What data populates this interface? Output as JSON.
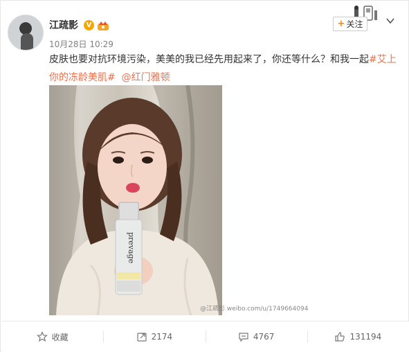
{
  "user": {
    "name": "江疏影",
    "verified_badge": "V",
    "timestamp": "10月28日 10:29"
  },
  "follow_button": {
    "plus": "+",
    "label": "关注"
  },
  "post": {
    "text_main": "皮肤也要对抗环境污染，美美的我已经先用起来了，你还等什么？和我一起",
    "topic": "#艾上你的冻龄美肌#",
    "mention": "@红门雅顿"
  },
  "photo": {
    "bottle_text": "prevage",
    "watermark": "@江疏影 weibo.com/u/1749664094"
  },
  "actions": {
    "favorite_label": "收藏",
    "repost_count": "2174",
    "comment_count": "4767",
    "like_count": "131194"
  },
  "colors": {
    "accent": "#eb7350",
    "follow_plus": "#ff8200",
    "verified": "#f7a600"
  }
}
